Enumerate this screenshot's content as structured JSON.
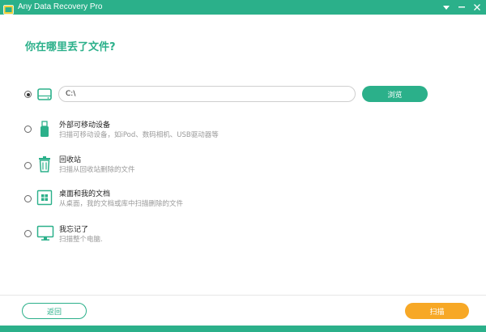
{
  "window": {
    "title": "Any Data Recovery Pro",
    "accent_color": "#2bb08a",
    "secondary_color": "#f7a826"
  },
  "main": {
    "question": "你在哪里丢了文件?",
    "options": [
      {
        "icon": "hard-drive-icon",
        "selected": true,
        "path_value": "C:\\",
        "browse_label": "浏览"
      },
      {
        "icon": "usb-drive-icon",
        "selected": false,
        "title": "外部可移动设备",
        "description": "扫描可移动设备，如iPod、数码相机、USB驱动器等"
      },
      {
        "icon": "recycle-bin-icon",
        "selected": false,
        "title": "回收站",
        "description": "扫描从回收站删除的文件"
      },
      {
        "icon": "windows-desktop-icon",
        "selected": false,
        "title": "桌面和我的文档",
        "description": "从桌面，我的文档或库中扫描删除的文件"
      },
      {
        "icon": "monitor-icon",
        "selected": false,
        "title": "我忘记了",
        "description": "扫描整个电脑."
      }
    ]
  },
  "footer": {
    "back_label": "返回",
    "scan_label": "扫描"
  }
}
